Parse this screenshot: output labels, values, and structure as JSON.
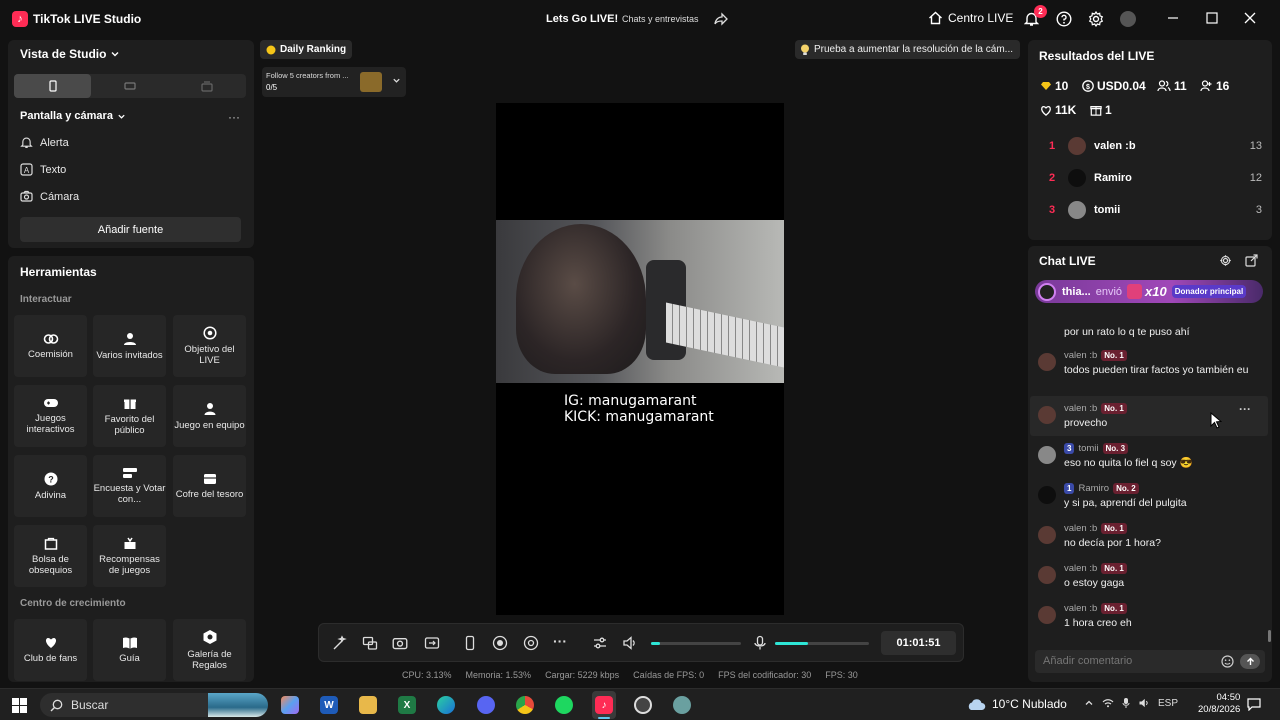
{
  "titlebar": {
    "app_title": "TikTok LIVE Studio",
    "stream_title": "Lets Go LIVE!",
    "stream_category": "Chats y entrevistas",
    "live_center": "Centro LIVE",
    "notification_count": "2"
  },
  "left": {
    "studio_view": "Vista de Studio",
    "screen_camera": "Pantalla y cámara",
    "more": "···",
    "sources": [
      "Alerta",
      "Texto",
      "Cámara"
    ],
    "add_source": "Añadir fuente",
    "tools_title": "Herramientas",
    "interact_section": "Interactuar",
    "interact_tools": [
      {
        "label": "Coemisión",
        "icon": "link-icon"
      },
      {
        "label": "Varios invitados",
        "icon": "group-icon"
      },
      {
        "label": "Objetivo del LIVE",
        "icon": "target-icon"
      },
      {
        "label": "Juegos interactivos",
        "icon": "gamepad-icon"
      },
      {
        "label": "Favorito del público",
        "icon": "gift-icon"
      },
      {
        "label": "Juego en equipo",
        "icon": "team-icon"
      },
      {
        "label": "Adivina",
        "icon": "question-icon"
      },
      {
        "label": "Encuesta y Votar con...",
        "icon": "poll-icon"
      },
      {
        "label": "Cofre del tesoro",
        "icon": "chest-icon"
      },
      {
        "label": "Bolsa de obsequios",
        "icon": "bag-icon"
      },
      {
        "label": "Recompensas de juegos",
        "icon": "reward-icon"
      }
    ],
    "growth_section": "Centro de crecimiento",
    "growth_tools": [
      {
        "label": "Club de fans",
        "icon": "heart-icon"
      },
      {
        "label": "Guía",
        "icon": "book-icon"
      },
      {
        "label": "Galería de Regalos",
        "icon": "gallery-icon"
      }
    ]
  },
  "center": {
    "daily_ranking": "Daily Ranking",
    "follow_text": "Follow 5 creators from ...",
    "follow_count": "0/5",
    "tip": "Prueba a aumentar la resolución de la cám...",
    "overlay_ig": "IG: manugamarant",
    "overlay_kick": "KICK: manugamarant",
    "timer": "01:01:51",
    "volume_level": 0.1,
    "mic_level": 0.35,
    "stats": {
      "cpu": "CPU:  3.13%",
      "memory": "Memoria:  1.53%",
      "upload": "Cargar:  5229 kbps",
      "fps_drops": "Caídas de FPS:  0",
      "encoder_fps": "FPS del codificador:  30",
      "fps": "FPS:  30"
    }
  },
  "results": {
    "title": "Resultados del LIVE",
    "diamonds": "10",
    "usd": "USD0.04",
    "viewers": "11",
    "followers": "16",
    "likes": "11K",
    "gifts": "1",
    "ranking": [
      {
        "pos": "1",
        "name": "valen :b",
        "score": "13"
      },
      {
        "pos": "2",
        "name": "Ramiro",
        "score": "12"
      },
      {
        "pos": "3",
        "name": "tomii",
        "score": "3"
      }
    ]
  },
  "chat": {
    "title": "Chat LIVE",
    "gift_user": "thia...",
    "gift_verb": "envió",
    "gift_qty": "x10",
    "gift_tag": "Donador principal",
    "messages": [
      {
        "user": "",
        "level": "",
        "rank": "",
        "text": "por un rato lo q te puso ahí"
      },
      {
        "user": "valen :b",
        "level": "",
        "rank": "No. 1",
        "text": "todos pueden tirar factos yo también eu"
      },
      {
        "user": "valen :b",
        "level": "",
        "rank": "No. 1",
        "text": "provecho"
      },
      {
        "user": "tomii",
        "level": "3",
        "rank": "No. 3",
        "text": "eso no quita lo fiel q soy 😎"
      },
      {
        "user": "Ramiro",
        "level": "1",
        "rank": "No. 2",
        "text": "y si pa, aprendí del pulgita"
      },
      {
        "user": "valen :b",
        "level": "",
        "rank": "No. 1",
        "text": "no decía por 1 hora?"
      },
      {
        "user": "valen :b",
        "level": "",
        "rank": "No. 1",
        "text": "o estoy gaga"
      },
      {
        "user": "valen :b",
        "level": "",
        "rank": "No. 1",
        "text": "1 hora creo eh"
      }
    ],
    "input_placeholder": "Añadir comentario"
  },
  "taskbar": {
    "search": "Buscar",
    "weather": "10°C  Nublado",
    "lang": "ESP",
    "time": "04:50",
    "date": "20/8/2026"
  },
  "colors": {
    "accent": "#fe2c55",
    "teal": "#2ee6d6",
    "panel": "#1e1e1e",
    "bg": "#121212"
  }
}
